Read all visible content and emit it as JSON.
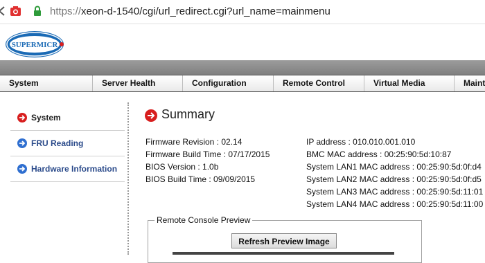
{
  "browser": {
    "url_scheme": "https://",
    "url_rest": "xeon-d-1540/cgi/url_redirect.cgi?url_name=mainmenu",
    "icons": [
      "back-icon",
      "recording-icon",
      "lock-icon"
    ]
  },
  "header": {
    "logo_text": "SUPERMICRO",
    "logo_color": "#1a6ab5",
    "accent_color": "#d81e1e"
  },
  "menu": {
    "items": [
      {
        "label": "System"
      },
      {
        "label": "Server Health"
      },
      {
        "label": "Configuration"
      },
      {
        "label": "Remote Control"
      },
      {
        "label": "Virtual Media"
      },
      {
        "label": "Maint"
      }
    ]
  },
  "sidebar": {
    "items": [
      {
        "label": "System",
        "icon": "arrow-right-red-icon",
        "active": true
      },
      {
        "label": "FRU Reading",
        "icon": "arrow-right-blue-icon"
      },
      {
        "label": "Hardware Information",
        "icon": "arrow-right-blue-icon"
      }
    ]
  },
  "summary": {
    "title": "Summary",
    "left": [
      {
        "label": "Firmware Revision :",
        "value": "02.14"
      },
      {
        "label": "Firmware Build Time :",
        "value": "07/17/2015"
      },
      {
        "label": "BIOS Version :",
        "value": "1.0b"
      },
      {
        "label": "BIOS Build Time :",
        "value": "09/09/2015"
      }
    ],
    "right": [
      {
        "label": "IP address :",
        "value": "010.010.001.010"
      },
      {
        "label": "BMC MAC address :",
        "value": "00:25:90:5d:10:87"
      },
      {
        "label": "System LAN1 MAC address :",
        "value": "00:25:90:5d:0f:d4"
      },
      {
        "label": "System LAN2 MAC address :",
        "value": "00:25:90:5d:0f:d5"
      },
      {
        "label": "System LAN3 MAC address :",
        "value": "00:25:90:5d:11:01"
      },
      {
        "label": "System LAN4 MAC address :",
        "value": "00:25:90:5d:11:00"
      }
    ]
  },
  "console": {
    "legend": "Remote Console Preview",
    "refresh_label": "Refresh Preview Image"
  }
}
